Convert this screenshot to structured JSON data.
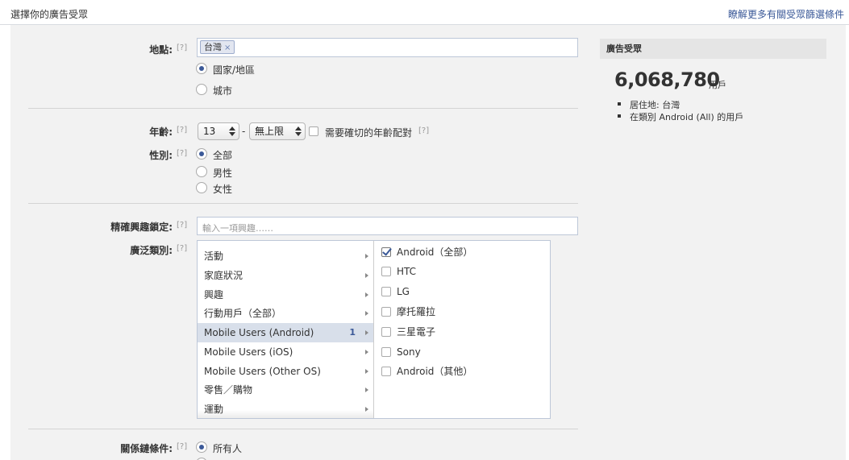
{
  "header": {
    "title": "選擇你的廣告受眾",
    "learn_more": "瞭解更多有關受眾篩選條件"
  },
  "help_mark": "[?]",
  "location": {
    "label": "地點:",
    "token": "台灣",
    "token_remove": "×",
    "options": [
      {
        "label": "國家/地區",
        "selected": true
      },
      {
        "label": "城市",
        "selected": false
      }
    ]
  },
  "age": {
    "label": "年齡:",
    "min": "13",
    "dash": "-",
    "max": "無上限",
    "exact_match_label": "需要確切的年齡配對",
    "exact_match_checked": false
  },
  "gender": {
    "label": "性別:",
    "options": [
      {
        "label": "全部",
        "selected": true
      },
      {
        "label": "男性",
        "selected": false
      },
      {
        "label": "女性",
        "selected": false
      }
    ]
  },
  "precise_interests": {
    "label": "精確興趣鎖定:",
    "placeholder": "輸入一項興趣……"
  },
  "broad_categories": {
    "label": "廣泛類別:",
    "categories": [
      {
        "label": "活動",
        "count": ""
      },
      {
        "label": "家庭狀況",
        "count": ""
      },
      {
        "label": "興趣",
        "count": ""
      },
      {
        "label": "行動用戶（全部）",
        "count": ""
      },
      {
        "label": "Mobile Users (Android)",
        "count": "1",
        "selected": true
      },
      {
        "label": "Mobile Users (iOS)",
        "count": ""
      },
      {
        "label": "Mobile Users (Other OS)",
        "count": ""
      },
      {
        "label": "零售／購物",
        "count": ""
      },
      {
        "label": "運動",
        "count": ""
      }
    ],
    "subcategories": [
      {
        "label": "Android（全部）",
        "checked": true
      },
      {
        "label": "HTC",
        "checked": false
      },
      {
        "label": "LG",
        "checked": false
      },
      {
        "label": "摩托羅拉",
        "checked": false
      },
      {
        "label": "三星電子",
        "checked": false
      },
      {
        "label": "Sony",
        "checked": false
      },
      {
        "label": "Android（其他）",
        "checked": false
      }
    ]
  },
  "relationship": {
    "label": "關係鏈條件:",
    "options": [
      {
        "label": "所有人",
        "selected": true
      }
    ]
  },
  "audience": {
    "title": "廣告受眾",
    "count": "6,068,780",
    "unit": "用戶",
    "bullets": [
      "居住地: 台灣",
      "在類別 Android (All) 的用戶"
    ]
  },
  "colors": {
    "accent": "#3b5998",
    "panel_bg": "#f2f2f2",
    "selected_row": "#d8dfea"
  }
}
